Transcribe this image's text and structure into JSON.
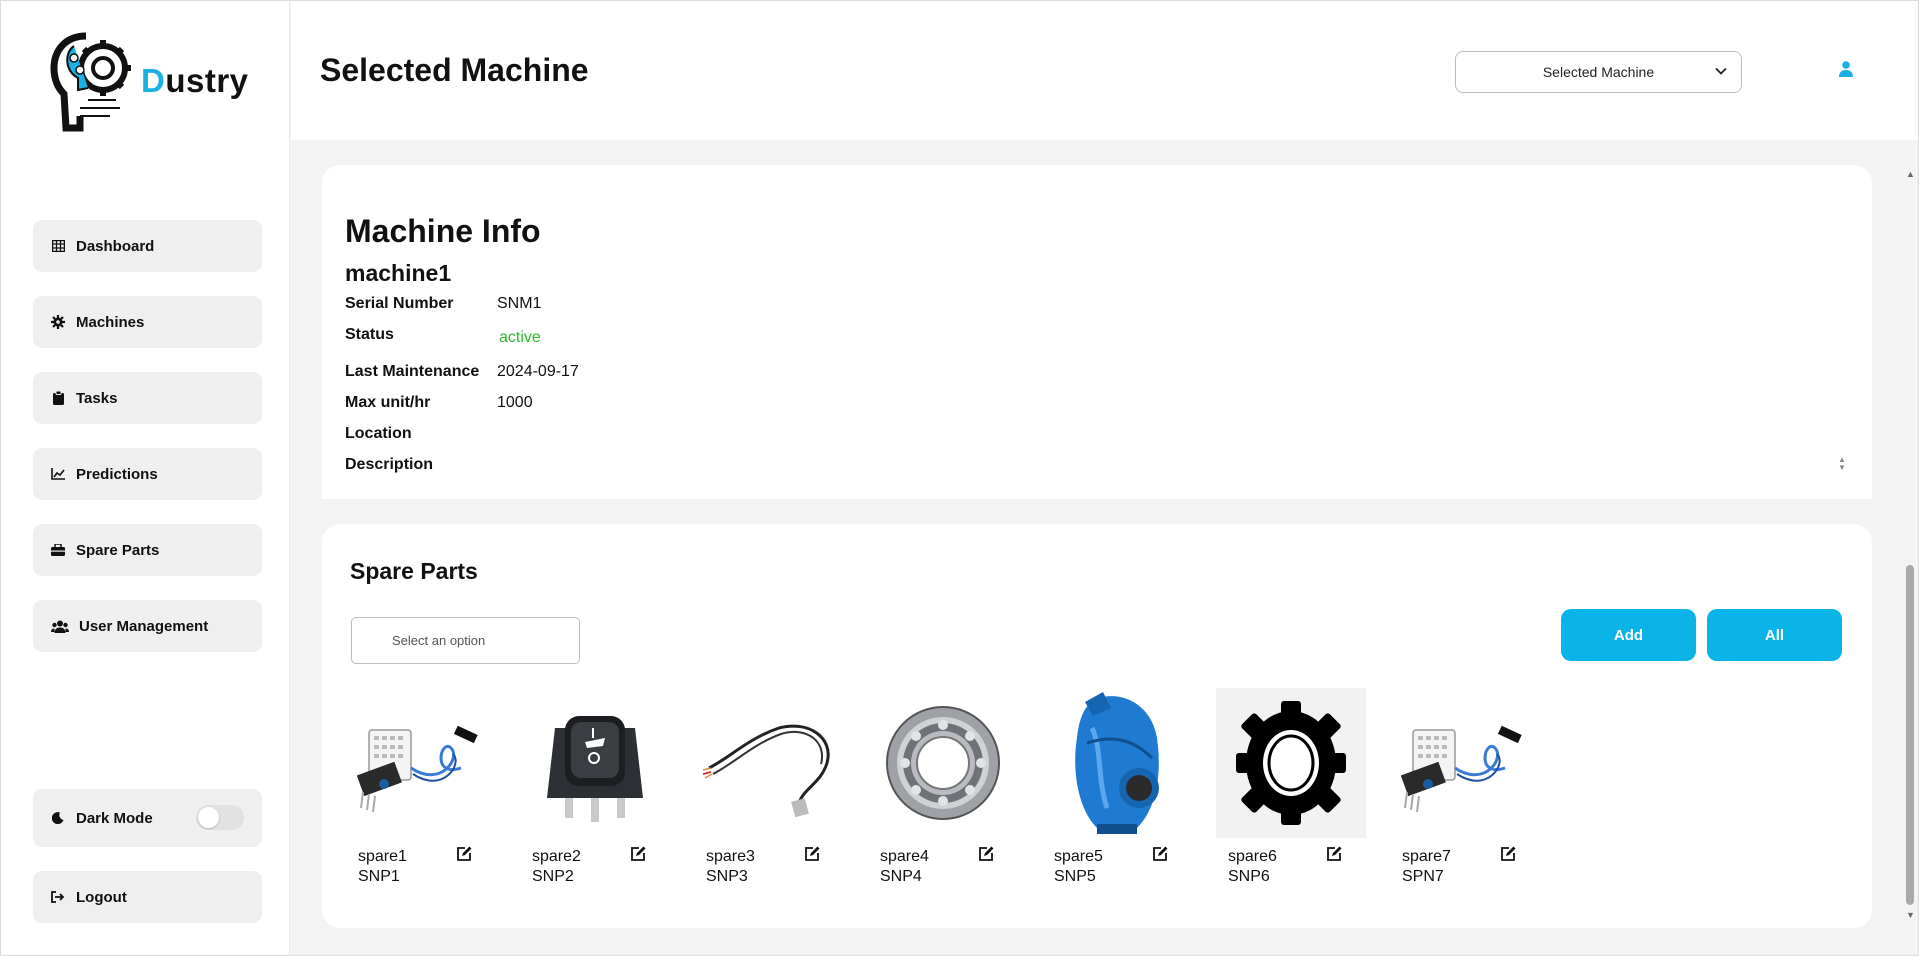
{
  "brand": {
    "name_first": "D",
    "name_rest": "ustry"
  },
  "sidebar": {
    "items": [
      {
        "label": "Dashboard",
        "icon": "table-icon"
      },
      {
        "label": "Machines",
        "icon": "gear-icon"
      },
      {
        "label": "Tasks",
        "icon": "clipboard-icon"
      },
      {
        "label": "Predictions",
        "icon": "line-chart-icon"
      },
      {
        "label": "Spare Parts",
        "icon": "toolbox-icon"
      },
      {
        "label": "User Management",
        "icon": "users-icon"
      }
    ],
    "dark_mode_label": "Dark Mode",
    "dark_mode_on": false,
    "logout_label": "Logout"
  },
  "header": {
    "title": "Selected Machine",
    "select_value": "Selected Machine"
  },
  "machine_info": {
    "title": "Machine Info",
    "name": "machine1",
    "fields": [
      {
        "label": "Serial Number",
        "value": "SNM1"
      },
      {
        "label": "Status",
        "value": "active"
      },
      {
        "label": "Last Maintenance",
        "value": "2024-09-17"
      },
      {
        "label": "Max unit/hr",
        "value": "1000"
      },
      {
        "label": "Location",
        "value": ""
      },
      {
        "label": "Description",
        "value": ""
      }
    ],
    "status_color": "#2fb82f"
  },
  "spare_parts": {
    "title": "Spare Parts",
    "select_placeholder": "Select an option",
    "add_label": "Add",
    "all_label": "All",
    "accent": "#0ab4e8",
    "items": [
      {
        "name": "spare1",
        "serial": "SNP1",
        "image": "sensor-module"
      },
      {
        "name": "spare2",
        "serial": "SNP2",
        "image": "rocker-switch"
      },
      {
        "name": "spare3",
        "serial": "SNP3",
        "image": "temperature-probe-cable"
      },
      {
        "name": "spare4",
        "serial": "SNP4",
        "image": "ball-bearing"
      },
      {
        "name": "spare5",
        "serial": "SNP5",
        "image": "blue-pump"
      },
      {
        "name": "spare6",
        "serial": "SNP6",
        "image": "gear"
      },
      {
        "name": "spare7",
        "serial": "SPN7",
        "image": "sensor-module"
      }
    ]
  }
}
